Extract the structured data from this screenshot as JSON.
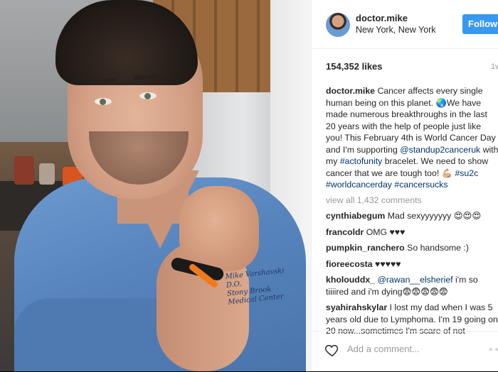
{
  "post": {
    "username": "doctor.mike",
    "location": "New York, New York",
    "follow_label": "Follow",
    "likes": "154,352 likes",
    "age": "1w",
    "photo_text": [
      "Mike Varshavski D.O.",
      "Stony Brook Medical Center"
    ]
  },
  "caption": {
    "user": "doctor.mike",
    "text1": "Cancer affects every single human being on this planet. ",
    "globe": "🌏",
    "text2": "We have made numerous breakthroughs in the last 20 years with the help of people just like you! This February 4th is World Cancer Day and I'm supporting ",
    "mention": "@standup2canceruk",
    "text3": " with my ",
    "hashtag1": "#actofunity",
    "text4": " bracelet. We need to show cancer that we are tough too! ",
    "muscle": "💪🏼",
    "hashtags": "#su2c #worldcancerday #cancersucks"
  },
  "view_all": "view all 1,432 comments",
  "comments": [
    {
      "user": "cynthiabegum",
      "text": "Mad sexyyyyyyy ",
      "emoji": "😍😍😍"
    },
    {
      "user": "francoldr",
      "text": "OMG ♥♥♥"
    },
    {
      "user": "pumpkin_ranchero",
      "text": "So handsome :)"
    },
    {
      "user": "fioreecosta",
      "text": "♥♥♥♥♥"
    },
    {
      "user": "kholouddx_",
      "mention": "@rawan__elsherief",
      "text": " i'm so tiiiired and i'm dying",
      "emoji": "😨😨😨😨😨"
    },
    {
      "user": "syahirahskylar",
      "text": "I lost my dad when I was 5 years old due to Lymphoma. I'm 19 going on 20 now...sometimes I'm scare of not"
    }
  ],
  "footer": {
    "add_comment_placeholder": "Add a comment...",
    "more": "∘∘"
  }
}
